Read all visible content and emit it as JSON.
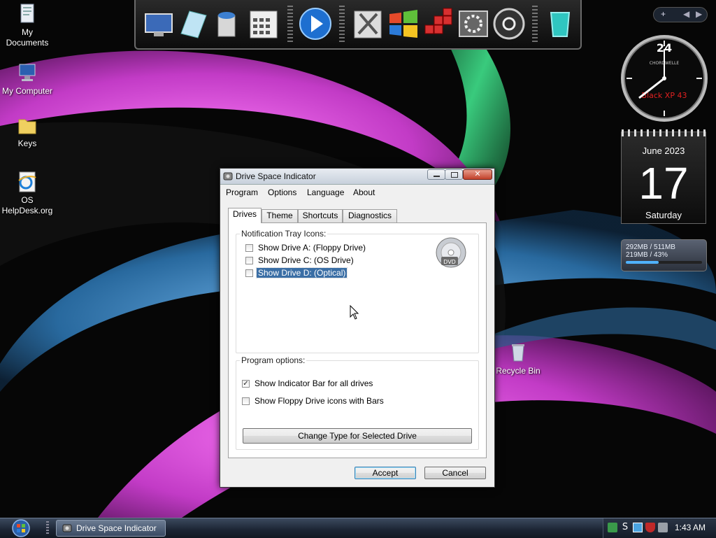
{
  "desktop": {
    "icons": [
      {
        "label": "My\nDocuments",
        "icon": "my-documents-icon"
      },
      {
        "label": "My Computer",
        "icon": "computer-icon"
      },
      {
        "label": "Keys",
        "icon": "folder-icon"
      },
      {
        "label": "OS\nHelpDesk.org",
        "icon": "internet-explorer-icon"
      },
      {
        "label": "Recycle Bin",
        "icon": "recycle-bin-icon"
      }
    ]
  },
  "dock": {
    "items": [
      "display-settings-icon",
      "notepad-icon",
      "paint-bucket-icon",
      "calculator-icon",
      "media-player-icon",
      "tools-icon",
      "windows-logo-icon",
      "registry-icon",
      "system-settings-icon",
      "power-icon",
      "recycle-icon"
    ]
  },
  "gadgets": {
    "clock": {
      "hour_label": "24",
      "brand": "CHORDWELLE",
      "caption": "Black XP 43"
    },
    "calendar": {
      "month_year": "June 2023",
      "day": "17",
      "weekday": "Saturday"
    },
    "drive_meter": {
      "line1": "292MB / 511MB",
      "line2": "219MB / 43%",
      "percent": 43
    }
  },
  "dialog": {
    "title": "Drive Space Indicator",
    "menu": [
      "Program",
      "Options",
      "Language",
      "About"
    ],
    "tabs": [
      "Drives",
      "Theme",
      "Shortcuts",
      "Diagnostics"
    ],
    "active_tab": "Drives",
    "tray_group": {
      "label": "Notification Tray Icons:",
      "items": [
        {
          "label": "Show Drive A: (Floppy Drive)",
          "checked": false
        },
        {
          "label": "Show Drive C: (OS Drive)",
          "checked": false
        },
        {
          "label": "Show Drive D: (Optical)",
          "checked": false,
          "selected": true
        }
      ],
      "drive_icon_label": "DVD"
    },
    "options_group": {
      "label": "Program options:",
      "items": [
        {
          "label": "Show Indicator Bar for all drives",
          "checked": true
        },
        {
          "label": "Show Floppy Drive icons with Bars",
          "checked": false
        }
      ],
      "change_button": "Change Type for Selected Drive"
    },
    "accept_button": "Accept",
    "cancel_button": "Cancel"
  },
  "taskbar": {
    "task_label": "Drive Space Indicator",
    "time": "1:43 AM"
  },
  "colors": {
    "selection": "#3a6ea5",
    "wallpaper_magenta": "#d24ad6",
    "wallpaper_blue": "#3a8fd0",
    "wallpaper_green": "#3fe08a"
  }
}
